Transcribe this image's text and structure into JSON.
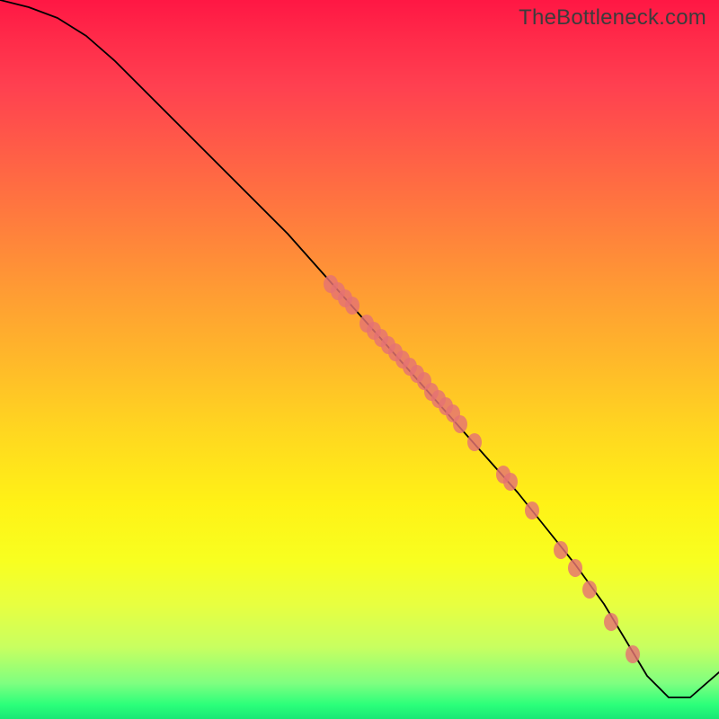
{
  "attribution": "TheBottleneck.com",
  "chart_data": {
    "type": "line",
    "title": "",
    "xlabel": "",
    "ylabel": "",
    "xlim": [
      0,
      100
    ],
    "ylim": [
      0,
      100
    ],
    "grid": false,
    "curve": {
      "x": [
        0,
        4,
        8,
        12,
        16,
        20,
        24,
        28,
        32,
        36,
        40,
        44,
        48,
        52,
        56,
        60,
        64,
        68,
        72,
        76,
        80,
        84,
        87,
        90,
        93,
        96,
        100
      ],
      "y": [
        100,
        99,
        97.5,
        95,
        91.5,
        87.5,
        83.5,
        79.5,
        75.5,
        71.5,
        67.5,
        63,
        58.5,
        54,
        49.5,
        45,
        40.5,
        36,
        31.5,
        26.5,
        21.5,
        16,
        11,
        6,
        3,
        3,
        6.5
      ]
    },
    "series": [
      {
        "name": "points",
        "x": [
          46,
          47,
          48,
          49,
          51,
          52,
          53,
          54,
          55,
          56,
          57,
          58,
          59,
          60,
          61,
          62,
          63,
          64,
          66,
          70,
          71,
          74,
          78,
          80,
          82,
          85,
          88
        ],
        "y": [
          60.5,
          59.5,
          58.5,
          57.5,
          55,
          54,
          53,
          52,
          51,
          50,
          49,
          48,
          47,
          45.5,
          44.5,
          43.5,
          42.5,
          41,
          38.5,
          34,
          33,
          29,
          23.5,
          21,
          18,
          13.5,
          9
        ]
      }
    ]
  },
  "colors": {
    "point_fill": "#e57373",
    "curve_stroke": "#000000"
  }
}
